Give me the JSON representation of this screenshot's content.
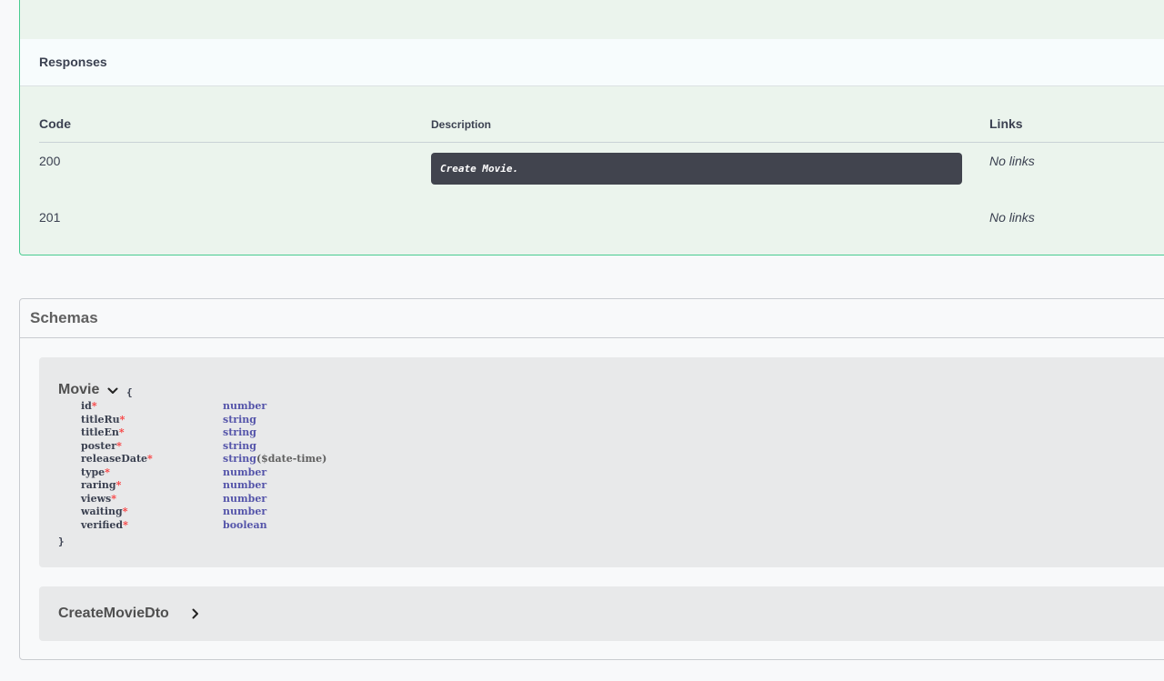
{
  "responses": {
    "section_title": "Responses",
    "headers": {
      "code": "Code",
      "description": "Description",
      "links": "Links"
    },
    "rows": [
      {
        "code": "200",
        "description": "Create Movie.",
        "links": "No links"
      },
      {
        "code": "201",
        "description": "",
        "links": "No links"
      }
    ]
  },
  "schemas": {
    "title": "Schemas",
    "models": [
      {
        "name": "Movie",
        "open_brace": "{",
        "close_brace": "}",
        "properties": [
          {
            "name": "id",
            "required_mark": "*",
            "type": "number",
            "format": ""
          },
          {
            "name": "titleRu",
            "required_mark": "*",
            "type": "string",
            "format": ""
          },
          {
            "name": "titleEn",
            "required_mark": "*",
            "type": "string",
            "format": ""
          },
          {
            "name": "poster",
            "required_mark": "*",
            "type": "string",
            "format": ""
          },
          {
            "name": "releaseDate",
            "required_mark": "*",
            "type": "string",
            "format": "($date-time)"
          },
          {
            "name": "type",
            "required_mark": "*",
            "type": "number",
            "format": ""
          },
          {
            "name": "raring",
            "required_mark": "*",
            "type": "number",
            "format": ""
          },
          {
            "name": "views",
            "required_mark": "*",
            "type": "number",
            "format": ""
          },
          {
            "name": "waiting",
            "required_mark": "*",
            "type": "number",
            "format": ""
          },
          {
            "name": "verified",
            "required_mark": "*",
            "type": "boolean",
            "format": ""
          }
        ]
      },
      {
        "name": "CreateMovieDto"
      }
    ]
  },
  "icons": {
    "movie_toggle": "chevron-down-icon",
    "dto_toggle": "chevron-right-icon"
  },
  "colors": {
    "opblock_border": "#49cc90",
    "opblock_bg": "#ebf4ed",
    "required_mark": "#f93e3e",
    "prop_type": "#5555aa",
    "description_box": "#41444e"
  }
}
